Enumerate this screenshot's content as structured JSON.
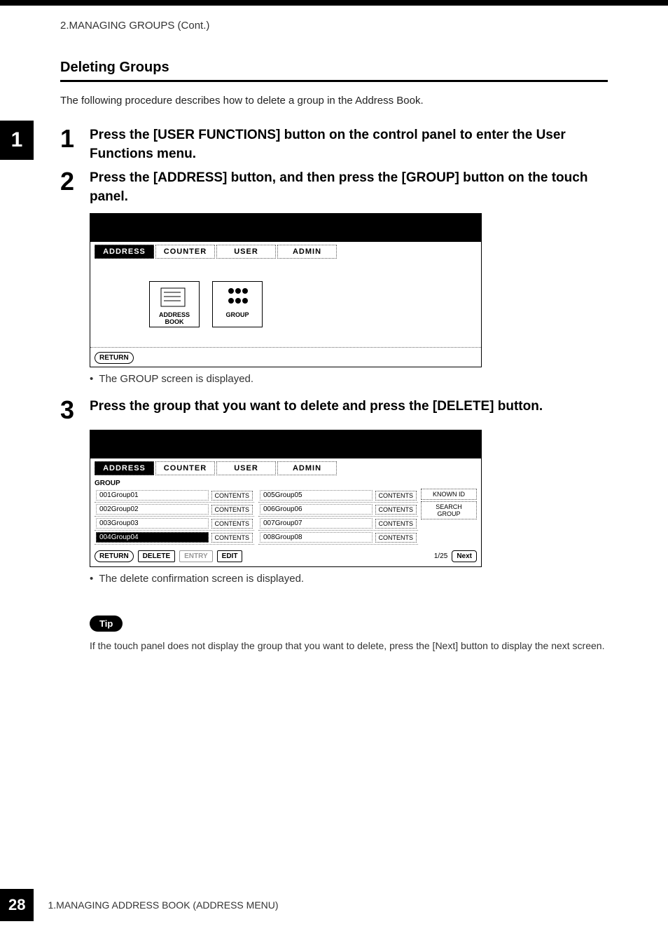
{
  "header": {
    "cont": "2.MANAGING GROUPS (Cont.)"
  },
  "chapter": {
    "side_num": "1"
  },
  "section": {
    "title": "Deleting Groups"
  },
  "intro": "The following procedure describes how to delete a group in the Address Book.",
  "steps": [
    {
      "num": "1",
      "text": "Press the [USER FUNCTIONS] button on the control panel to enter the User Functions menu."
    },
    {
      "num": "2",
      "text": "Press the [ADDRESS] button, and then press the [GROUP] button on the touch panel."
    },
    {
      "num": "3",
      "text": "Press the group that you want to delete and press the [DELETE] button."
    }
  ],
  "screen1": {
    "tabs": {
      "address": "ADDRESS",
      "counter": "COUNTER",
      "user": "USER",
      "admin": "ADMIN"
    },
    "icon_buttons": {
      "addressbook": "ADDRESS BOOK",
      "group": "GROUP"
    },
    "return": "RETURN"
  },
  "bullet1": "The GROUP screen is displayed.",
  "screen2": {
    "tabs": {
      "address": "ADDRESS",
      "counter": "COUNTER",
      "user": "USER",
      "admin": "ADMIN"
    },
    "header": "GROUP",
    "side": {
      "known": "KNOWN ID",
      "search": "SEARCH GROUP"
    },
    "left_rows": [
      {
        "id": "001",
        "name": "Group01"
      },
      {
        "id": "002",
        "name": "Group02"
      },
      {
        "id": "003",
        "name": "Group03"
      },
      {
        "id": "004",
        "name": "Group04"
      }
    ],
    "right_rows": [
      {
        "id": "005",
        "name": "Group05"
      },
      {
        "id": "006",
        "name": "Group06"
      },
      {
        "id": "007",
        "name": "Group07"
      },
      {
        "id": "008",
        "name": "Group08"
      }
    ],
    "contents_label": "CONTENTS",
    "bottom": {
      "return": "RETURN",
      "delete": "DELETE",
      "entry": "ENTRY",
      "edit": "EDIT",
      "pager": "1/25",
      "next": "Next"
    }
  },
  "bullet2": "The delete confirmation screen is displayed.",
  "tip": {
    "label": "Tip",
    "text": "If the touch panel does not display the group that you want to delete, press the [Next] button to display the next screen."
  },
  "footer": {
    "page": "28",
    "label": "1.MANAGING ADDRESS BOOK (ADDRESS MENU)"
  }
}
